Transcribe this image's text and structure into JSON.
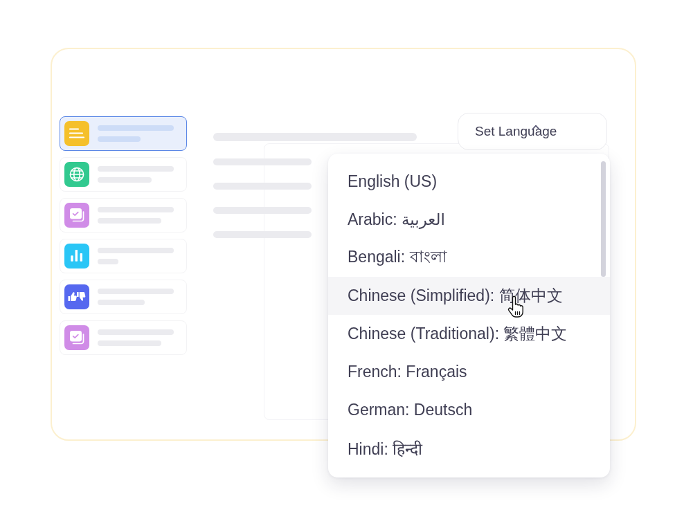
{
  "sidebar": {
    "items": [
      {
        "selected": true,
        "color": "#f5c02a"
      },
      {
        "selected": false,
        "color": "#31c98f"
      },
      {
        "selected": false,
        "color": "#d08ce7"
      },
      {
        "selected": false,
        "color": "#2ac6f6"
      },
      {
        "selected": false,
        "color": "#5668ef"
      },
      {
        "selected": false,
        "color": "#d08ce7"
      }
    ]
  },
  "language_button": {
    "label": "Set Language",
    "expanded": true
  },
  "language_menu": {
    "options": [
      {
        "label": "English (US)",
        "highlighted": false
      },
      {
        "label": "Arabic: العربية",
        "highlighted": false
      },
      {
        "label": "Bengali: বাংলা",
        "highlighted": false
      },
      {
        "label": "Chinese (Simplified): 简体中文",
        "highlighted": true
      },
      {
        "label": "Chinese (Traditional): 繁體中文",
        "highlighted": false
      },
      {
        "label": "French: Français",
        "highlighted": false
      },
      {
        "label": "German: Deutsch",
        "highlighted": false
      },
      {
        "label": "Hindi: हिन्दी",
        "highlighted": false
      }
    ]
  }
}
